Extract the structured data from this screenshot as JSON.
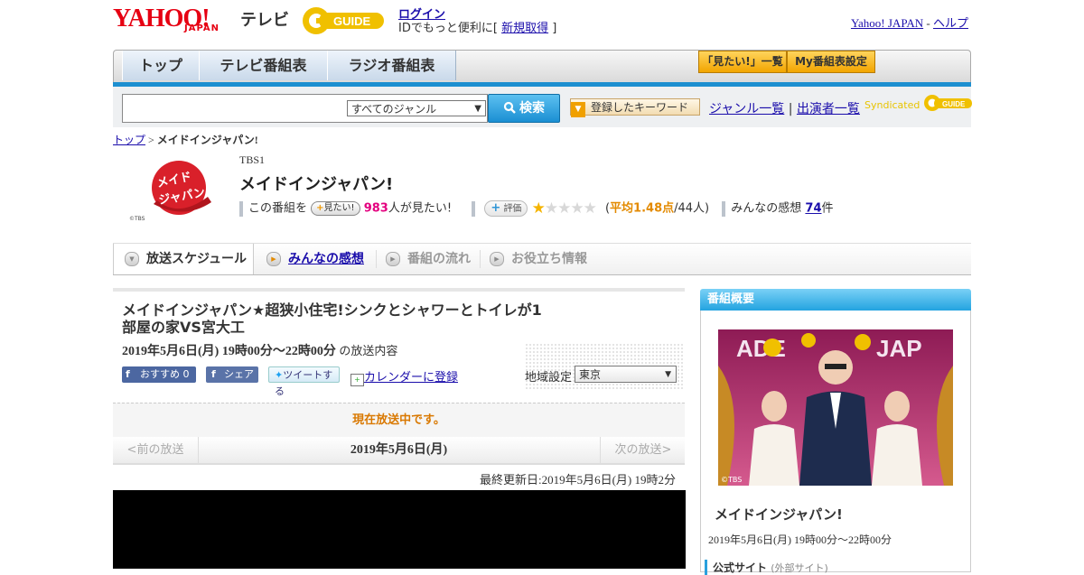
{
  "header": {
    "logo_yahoo": "YAHOO!",
    "logo_japan": "JAPAN",
    "logo_tv": "テレビ",
    "login": "ログイン",
    "login_sub_prefix": "IDでもっと便利に[",
    "register": "新規取得",
    "login_sub_suffix": "]",
    "yahoo_japan_link": "Yahoo! JAPAN",
    "separator": "-",
    "help_link": "ヘルプ"
  },
  "nav": {
    "tabs": [
      "トップ",
      "テレビ番組表",
      "ラジオ番組表"
    ],
    "mitai_list": "「見たい!」一覧",
    "my_schedule": "My番組表設定"
  },
  "search": {
    "genre_selected": "すべてのジャンル",
    "search_button": "検索",
    "keyword_button": "登録したキーワード",
    "genre_list": "ジャンル一覧",
    "divider": "|",
    "performer_list": "出演者一覧",
    "syndicated": "Syndicated"
  },
  "breadcrumb": {
    "top": "トップ",
    "sep": ">",
    "current": "メイドインジャパン!"
  },
  "program": {
    "channel": "TBS1",
    "title": "メイドインジャパン!",
    "logo_caption": "©TBS",
    "mitai_prefix": "この番組を",
    "mitai_button": "見たい!",
    "mitai_count": "983",
    "mitai_suffix": "人が見たい!",
    "eval_button": "評価",
    "rating_stars": 1.48,
    "rating_open": "(",
    "rating_avg": "平均1.48点",
    "rating_count": "/44人)",
    "impressions_label": "みんなの感想",
    "impressions_count": "74",
    "impressions_suffix": "件"
  },
  "subtabs": [
    "放送スケジュール",
    "みんなの感想",
    "番組の流れ",
    "お役立ち情報"
  ],
  "episode": {
    "title": "メイドインジャパン★超狭小住宅!シンクとシャワーとトイレが1部屋の家VS宮大工",
    "date": "2019年5月6日(月) 19時00分～22時00分",
    "date_suffix": "の放送内容",
    "fb_recommend": "おすすめ 0",
    "fb_share": "シェア",
    "tweet": "ツイートする",
    "calendar": "カレンダーに登録",
    "region_label": "地域設定",
    "region_value": "東京",
    "on_air": "現在放送中です。",
    "prev": "<前の放送",
    "pager_date": "2019年5月6日(月)",
    "next": "次の放送>",
    "updated": "最終更新日:2019年5月6日(月) 19時2分"
  },
  "sidebar": {
    "header": "番組概要",
    "image_caption": "©TBS",
    "title": "メイドインジャパン!",
    "date": "2019年5月6日(月) 19時00分～22時00分",
    "official_site": "公式サイト",
    "official_note": "(外部サイト)"
  },
  "colors": {
    "yahoo_red": "#e60012",
    "accent_blue": "#1d8fd0",
    "orange": "#e38a00",
    "pink": "#e4007f"
  }
}
